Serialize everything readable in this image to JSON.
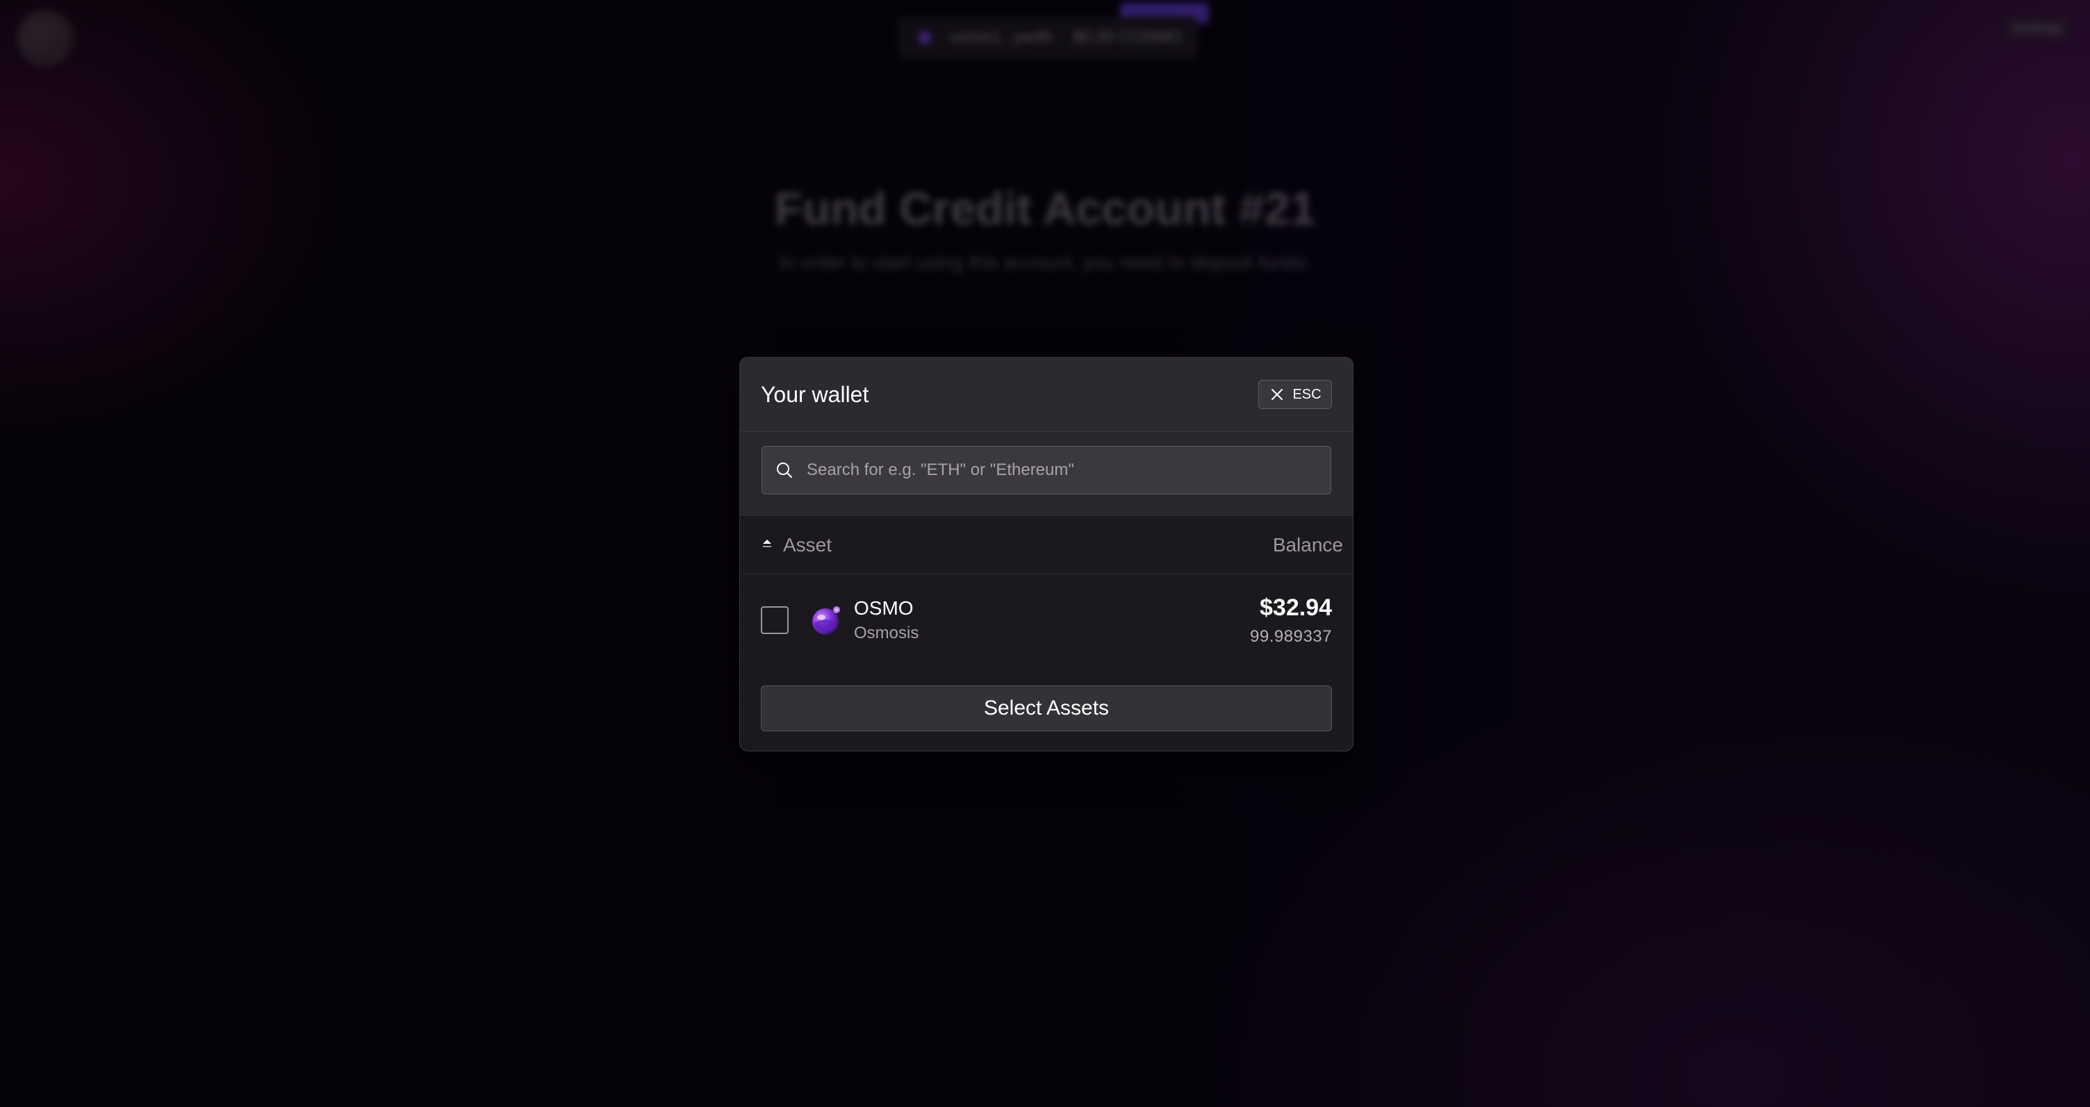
{
  "background": {
    "top_bar": {
      "wallet_address": "osmo1...yw4h",
      "balance": "$0.00 COSMO",
      "settings_label": "Settings"
    },
    "title": "Fund Credit Account #21",
    "subtitle": "In order to start using this account, you need to deposit funds."
  },
  "modal": {
    "title": "Your wallet",
    "close_label": "ESC",
    "search": {
      "placeholder": "Search for e.g. \"ETH\" or \"Ethereum\"",
      "value": ""
    },
    "table": {
      "columns": [
        "Asset",
        "Balance"
      ],
      "rows": [
        {
          "symbol": "OSMO",
          "name": "Osmosis",
          "value_usd": "$32.94",
          "amount": "99.989337",
          "selected": false,
          "icon": "osmosis-logo-icon"
        }
      ]
    },
    "submit_label": "Select Assets"
  },
  "colors": {
    "modal_bg": "#1c191e",
    "header_bg": "#2d2a2f",
    "accent_purple": "#6e3fd8"
  }
}
